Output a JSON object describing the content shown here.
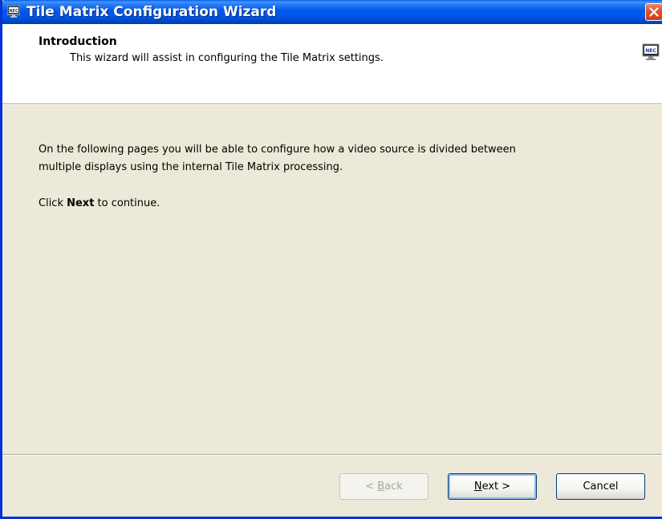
{
  "window": {
    "title": "Tile Matrix Configuration Wizard",
    "title_icon": "nec-monitor-icon",
    "close_icon": "close-icon",
    "accent_color": "#0058EE",
    "close_color": "#E0552F"
  },
  "header": {
    "title": "Introduction",
    "subtitle": "This wizard will assist in configuring the Tile Matrix settings.",
    "icon": "nec-monitor-icon"
  },
  "body": {
    "paragraph1_line1": "On the following pages you will be able to configure how a video source is divided between",
    "paragraph1_line2": "multiple displays using the internal Tile Matrix processing.",
    "paragraph2_prefix": "Click ",
    "paragraph2_bold": "Next",
    "paragraph2_suffix": " to continue."
  },
  "buttons": {
    "back_prefix": "< ",
    "back_mnemonic": "B",
    "back_rest": "ack",
    "back_enabled": false,
    "next_mnemonic": "N",
    "next_rest": "ext >",
    "next_enabled": true,
    "cancel_label": "Cancel",
    "cancel_enabled": true
  }
}
